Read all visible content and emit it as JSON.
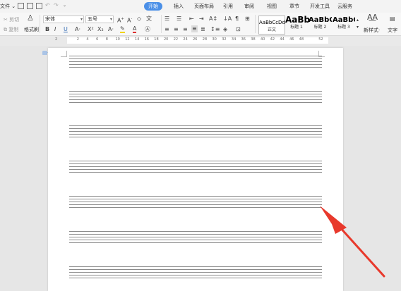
{
  "menubar": {
    "file_label": "文件",
    "tabs": [
      {
        "label": "开始",
        "active": true
      },
      {
        "label": "插入"
      },
      {
        "label": "页面布局"
      },
      {
        "label": "引用"
      },
      {
        "label": "审阅"
      },
      {
        "label": "视图"
      },
      {
        "label": "章节"
      },
      {
        "label": "开发工具"
      },
      {
        "label": "云服务"
      }
    ]
  },
  "ribbon": {
    "cut_label": "剪切",
    "copy_label": "复制",
    "format_painter_label": "格式刷",
    "font_name": "宋体",
    "font_size": "五号",
    "bold": "B",
    "italic": "I",
    "underline": "U",
    "styles": [
      {
        "preview": "AaBbCcDd",
        "label": "正文"
      },
      {
        "preview": "AaBb",
        "label": "标题 1"
      },
      {
        "preview": "AaBbC",
        "label": "标题 2"
      },
      {
        "preview": "AaBbC",
        "label": "标题 3"
      }
    ],
    "new_style_label": "新样式",
    "text_tool_label": "文字"
  },
  "ruler": {
    "numbers": [
      "2",
      "2",
      "4",
      "6",
      "8",
      "10",
      "12",
      "14",
      "16",
      "18",
      "20",
      "22",
      "24",
      "26",
      "28",
      "30",
      "32",
      "34",
      "36",
      "38",
      "40",
      "42",
      "44",
      "46",
      "48",
      "",
      "52"
    ]
  },
  "colors": {
    "accent": "#4a8fe7",
    "arrow": "#e8392c",
    "staff_line": "#8c8c8c"
  },
  "document": {
    "staff_count": 7,
    "lines_per_staff": 5
  }
}
